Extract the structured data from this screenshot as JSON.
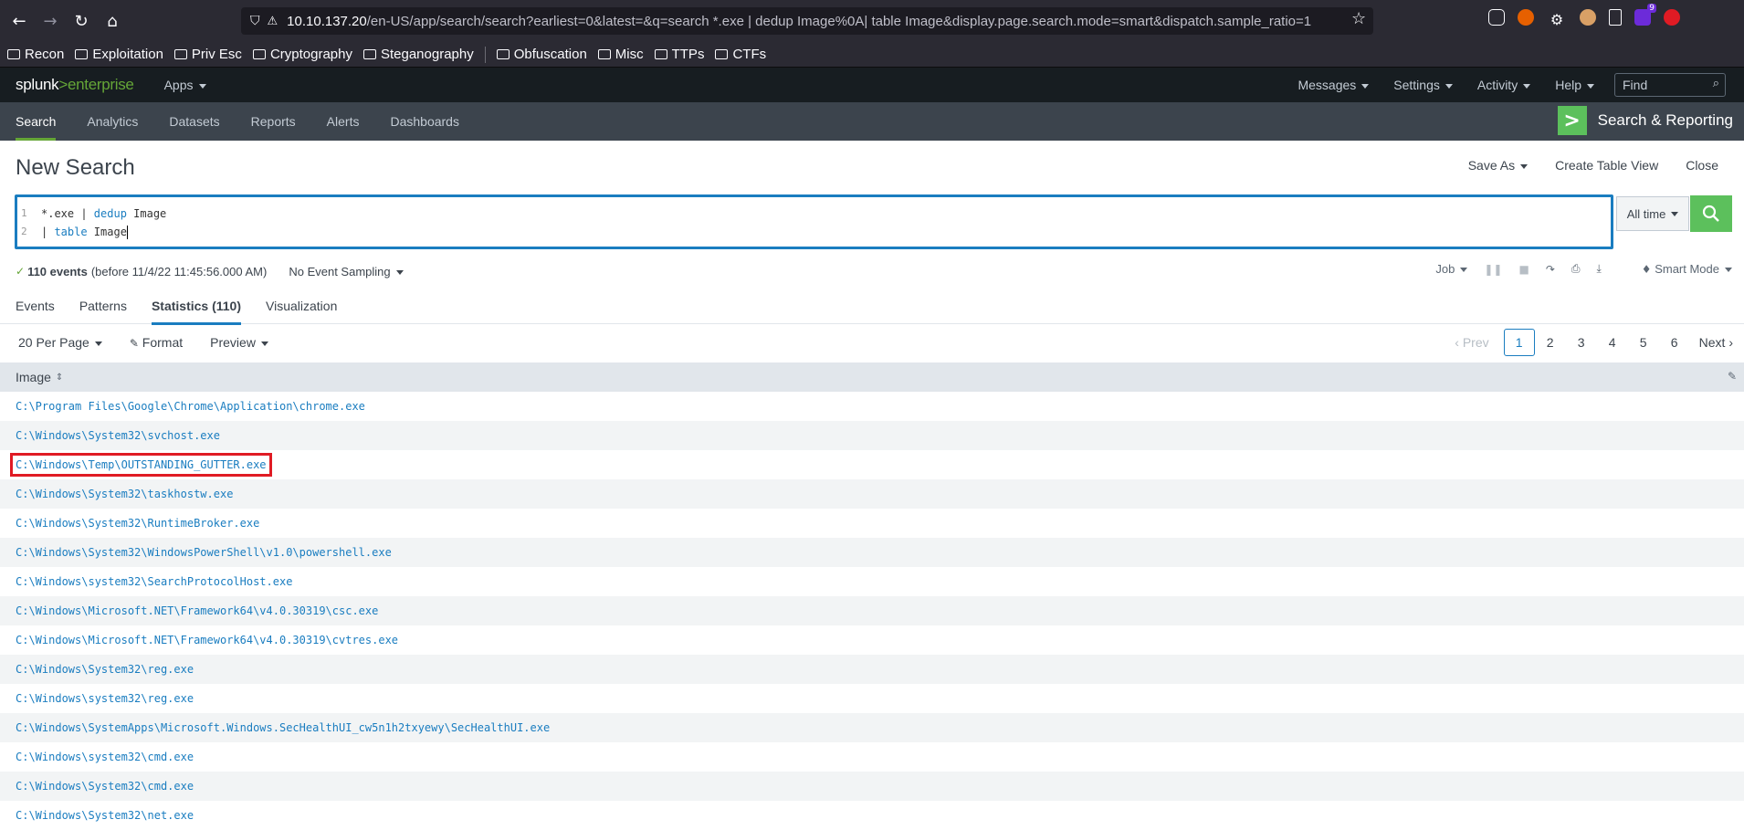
{
  "browser": {
    "url_host": "10.10.137.20",
    "url_path": "/en-US/app/search/search?earliest=0&latest=&q=search *.exe | dedup Image%0A| table Image&display.page.search.mode=smart&dispatch.sample_ratio=1",
    "extension_badge": "9",
    "bookmarks": [
      {
        "label": "Recon"
      },
      {
        "label": "Exploitation"
      },
      {
        "label": "Priv Esc"
      },
      {
        "label": "Cryptography"
      },
      {
        "label": "Steganography"
      },
      {
        "label": "Obfuscation"
      },
      {
        "label": "Misc"
      },
      {
        "label": "TTPs"
      },
      {
        "label": "CTFs"
      }
    ]
  },
  "splunk": {
    "logo_splunk": "splunk",
    "logo_gt": ">",
    "logo_enterprise": "enterprise",
    "apps_label": "Apps",
    "menu": {
      "messages": "Messages",
      "settings": "Settings",
      "activity": "Activity",
      "help": "Help",
      "find_placeholder": "Find"
    },
    "app_tabs": [
      "Search",
      "Analytics",
      "Datasets",
      "Reports",
      "Alerts",
      "Dashboards"
    ],
    "app_name": "Search & Reporting"
  },
  "page": {
    "title": "New Search",
    "actions": {
      "save_as": "Save As",
      "create_table_view": "Create Table View",
      "close": "Close"
    }
  },
  "search": {
    "line1_num": "1",
    "line2_num": "2",
    "line1_pre": "*.exe | ",
    "line1_kw": "dedup",
    "line1_post": " Image",
    "line2_pre": "| ",
    "line2_kw": "table",
    "line2_post": " Image",
    "time_range": "All time"
  },
  "status": {
    "event_count": "110 events",
    "event_meta": "(before 11/4/22 11:45:56.000 AM)",
    "sampling": "No Event Sampling",
    "job": "Job",
    "mode": "Smart Mode"
  },
  "result_tabs": {
    "events": "Events",
    "patterns": "Patterns",
    "statistics": "Statistics (110)",
    "visualization": "Visualization"
  },
  "controls": {
    "per_page": "20 Per Page",
    "format": "Format",
    "preview": "Preview"
  },
  "pager": {
    "prev": "Prev",
    "pages": [
      "1",
      "2",
      "3",
      "4",
      "5",
      "6"
    ],
    "next": "Next"
  },
  "table": {
    "column": "Image",
    "rows": [
      "C:\\Program Files\\Google\\Chrome\\Application\\chrome.exe",
      "C:\\Windows\\System32\\svchost.exe",
      "C:\\Windows\\Temp\\OUTSTANDING_GUTTER.exe",
      "C:\\Windows\\System32\\taskhostw.exe",
      "C:\\Windows\\System32\\RuntimeBroker.exe",
      "C:\\Windows\\System32\\WindowsPowerShell\\v1.0\\powershell.exe",
      "C:\\Windows\\system32\\SearchProtocolHost.exe",
      "C:\\Windows\\Microsoft.NET\\Framework64\\v4.0.30319\\csc.exe",
      "C:\\Windows\\Microsoft.NET\\Framework64\\v4.0.30319\\cvtres.exe",
      "C:\\Windows\\System32\\reg.exe",
      "C:\\Windows\\system32\\reg.exe",
      "C:\\Windows\\SystemApps\\Microsoft.Windows.SecHealthUI_cw5n1h2txyewy\\SecHealthUI.exe",
      "C:\\Windows\\system32\\cmd.exe",
      "C:\\Windows\\System32\\cmd.exe",
      "C:\\Windows\\System32\\net.exe"
    ]
  },
  "colors": {
    "splunk_green": "#65a637",
    "link_blue": "#1a7dc0",
    "highlight_red": "#e01b24"
  }
}
